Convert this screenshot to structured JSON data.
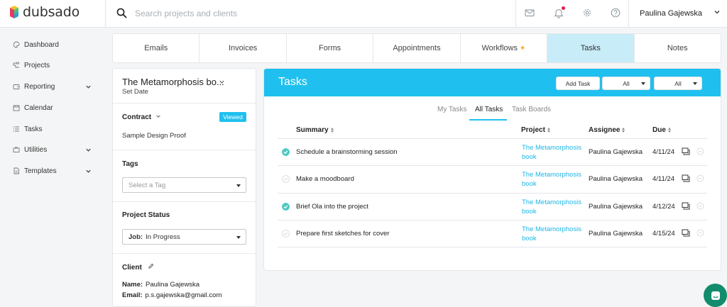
{
  "app": {
    "logo_text": "dubsado",
    "search_placeholder": "Search projects and clients",
    "user_name": "Paulina Gajewska",
    "accent_color": "#1fc0ef",
    "notification_color": "#e0204b"
  },
  "sidebar": {
    "items": [
      {
        "label": "Dashboard",
        "icon": "palette-icon"
      },
      {
        "label": "Projects",
        "icon": "projects-icon"
      },
      {
        "label": "Reporting",
        "icon": "wallet-icon"
      },
      {
        "label": "Calendar",
        "icon": "calendar-icon"
      },
      {
        "label": "Tasks",
        "icon": "list-icon"
      },
      {
        "label": "Utilities",
        "icon": "briefcase-icon"
      },
      {
        "label": "Templates",
        "icon": "document-icon"
      }
    ]
  },
  "tabs": [
    "Emails",
    "Invoices",
    "Forms",
    "Appointments",
    "Workflows",
    "Tasks",
    "Notes"
  ],
  "project": {
    "title": "The Metamorphosis bo...",
    "subtitle": "Set Date",
    "contract_label": "Contract",
    "contract_status": "Viewed",
    "contract_name": "Sample Design Proof",
    "tags_label": "Tags",
    "tags_placeholder": "Select a Tag",
    "status_label": "Project Status",
    "status_prefix": "Job:",
    "status_value": "In Progress",
    "client_label": "Client",
    "client_name_label": "Name:",
    "client_name": "Paulina Gajewska",
    "client_email_label": "Email:",
    "client_email": "p.s.gajewska@gmail.com"
  },
  "tasks": {
    "title": "Tasks",
    "add_button": "Add Task",
    "filter1": "All",
    "filter2": "All",
    "subtabs": [
      "My Tasks",
      "All Tasks",
      "Task Boards"
    ],
    "columns": [
      "Summary",
      "Project",
      "Assignee",
      "Due"
    ],
    "rows": [
      {
        "done": true,
        "summary": "Schedule a brainstorming session",
        "project_line1": "The Metamorphosis",
        "project_line2": "book",
        "assignee": "Paulina Gajewska",
        "due": "4/11/24"
      },
      {
        "done": false,
        "summary": "Make a moodboard",
        "project_line1": "The Metamorphosis",
        "project_line2": "book",
        "assignee": "Paulina Gajewska",
        "due": "4/11/24"
      },
      {
        "done": true,
        "summary": "Brief Ola into the project",
        "project_line1": "The Metamorphosis",
        "project_line2": "book",
        "assignee": "Paulina Gajewska",
        "due": "4/12/24"
      },
      {
        "done": false,
        "summary": "Prepare first sketches for cover",
        "project_line1": "The Metamorphosis",
        "project_line2": "book",
        "assignee": "Paulina Gajewska",
        "due": "4/15/24"
      }
    ]
  }
}
